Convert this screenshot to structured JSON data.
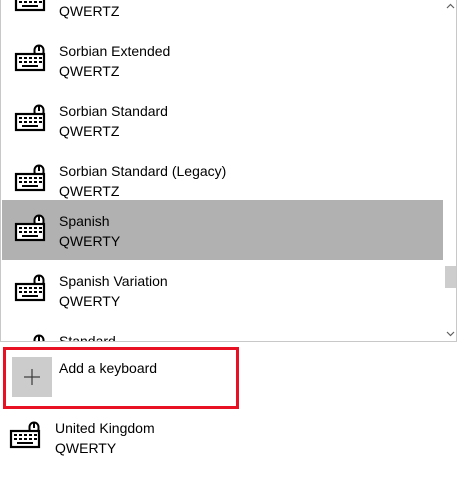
{
  "keyboard_list": {
    "items": [
      {
        "name": "",
        "layout": "QWERTZ",
        "icon": "keyboard-icon",
        "selected": false
      },
      {
        "name": "Sorbian Extended",
        "layout": "QWERTZ",
        "icon": "keyboard-icon",
        "selected": false
      },
      {
        "name": "Sorbian Standard",
        "layout": "QWERTZ",
        "icon": "keyboard-icon",
        "selected": false
      },
      {
        "name": "Sorbian Standard (Legacy)",
        "layout": "QWERTZ",
        "icon": "keyboard-icon",
        "selected": false
      },
      {
        "name": "Spanish",
        "layout": "QWERTY",
        "icon": "keyboard-icon",
        "selected": true
      },
      {
        "name": "Spanish Variation",
        "layout": "QWERTY",
        "icon": "keyboard-icon",
        "selected": false
      },
      {
        "name": "Standard",
        "layout": "",
        "icon": "keyboard-icon",
        "selected": false
      }
    ],
    "selected_color": "#b1b1b1"
  },
  "add_keyboard": {
    "label": "Add a keyboard",
    "icon": "plus-icon",
    "highlight_color": "#e81123"
  },
  "installed_keyboard": {
    "name": "United Kingdom",
    "layout": "QWERTY",
    "icon": "keyboard-icon"
  }
}
